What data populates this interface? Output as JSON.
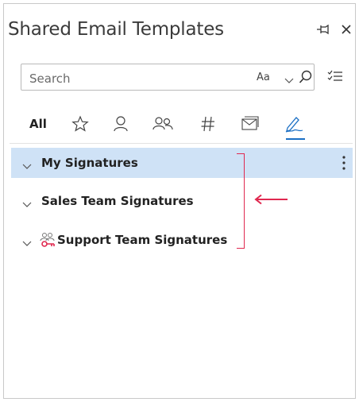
{
  "window": {
    "title": "Shared Email Templates"
  },
  "search": {
    "placeholder": "Search",
    "match_case_label": "Aa"
  },
  "tabs": [
    {
      "label": "All",
      "icon": "all"
    },
    {
      "label": "",
      "icon": "star-icon"
    },
    {
      "label": "",
      "icon": "person-icon"
    },
    {
      "label": "",
      "icon": "people-icon"
    },
    {
      "label": "",
      "icon": "hashtag-icon"
    },
    {
      "label": "",
      "icon": "mail-icon"
    },
    {
      "label": "",
      "icon": "signature-icon",
      "active": true
    }
  ],
  "tree": {
    "items": [
      {
        "label": "My Signatures",
        "selected": true
      },
      {
        "label": "Sales Team Signatures",
        "selected": false
      },
      {
        "label": "Support Team Signatures",
        "selected": false,
        "shared_icon": true
      }
    ]
  },
  "colors": {
    "accent": "#1a6fc4",
    "selection": "#cfe2f6",
    "annotation": "#e0284f"
  }
}
